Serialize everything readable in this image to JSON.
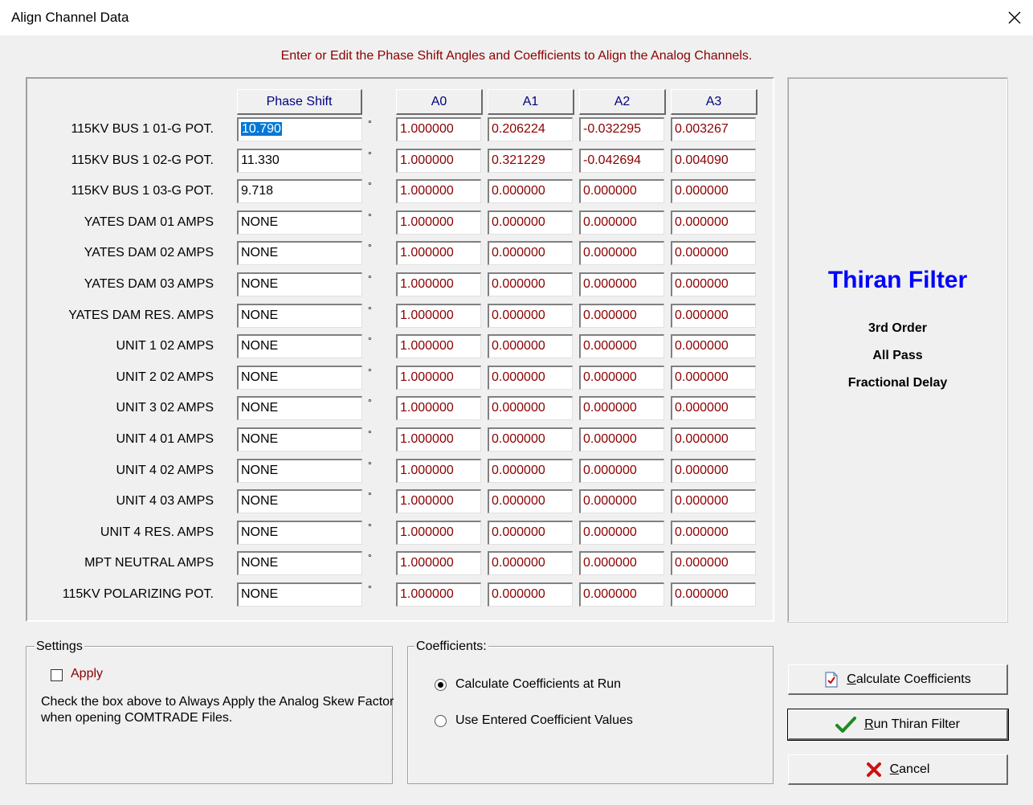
{
  "window": {
    "title": "Align Channel Data",
    "close_symbol": "✕"
  },
  "instruction": "Enter or Edit the Phase Shift Angles and Coefficients to Align the Analog Channels.",
  "headers": {
    "phase_shift": "Phase Shift",
    "a0": "A0",
    "a1": "A1",
    "a2": "A2",
    "a3": "A3"
  },
  "degree_symbol": "°",
  "rows": [
    {
      "label": "115KV BUS 1 01-G POT.",
      "phase": "10.790",
      "a0": "1.000000",
      "a1": "0.206224",
      "a2": "-0.032295",
      "a3": "0.003267"
    },
    {
      "label": "115KV BUS 1 02-G POT.",
      "phase": "11.330",
      "a0": "1.000000",
      "a1": "0.321229",
      "a2": "-0.042694",
      "a3": "0.004090"
    },
    {
      "label": "115KV BUS 1 03-G POT.",
      "phase": "9.718",
      "a0": "1.000000",
      "a1": "0.000000",
      "a2": "0.000000",
      "a3": "0.000000"
    },
    {
      "label": "YATES DAM 01 AMPS",
      "phase": "NONE",
      "a0": "1.000000",
      "a1": "0.000000",
      "a2": "0.000000",
      "a3": "0.000000"
    },
    {
      "label": "YATES DAM 02 AMPS",
      "phase": "NONE",
      "a0": "1.000000",
      "a1": "0.000000",
      "a2": "0.000000",
      "a3": "0.000000"
    },
    {
      "label": "YATES DAM 03 AMPS",
      "phase": "NONE",
      "a0": "1.000000",
      "a1": "0.000000",
      "a2": "0.000000",
      "a3": "0.000000"
    },
    {
      "label": "YATES DAM RES. AMPS",
      "phase": "NONE",
      "a0": "1.000000",
      "a1": "0.000000",
      "a2": "0.000000",
      "a3": "0.000000"
    },
    {
      "label": "UNIT 1 02 AMPS",
      "phase": "NONE",
      "a0": "1.000000",
      "a1": "0.000000",
      "a2": "0.000000",
      "a3": "0.000000"
    },
    {
      "label": "UNIT 2 02 AMPS",
      "phase": "NONE",
      "a0": "1.000000",
      "a1": "0.000000",
      "a2": "0.000000",
      "a3": "0.000000"
    },
    {
      "label": "UNIT 3 02 AMPS",
      "phase": "NONE",
      "a0": "1.000000",
      "a1": "0.000000",
      "a2": "0.000000",
      "a3": "0.000000"
    },
    {
      "label": "UNIT 4 01 AMPS",
      "phase": "NONE",
      "a0": "1.000000",
      "a1": "0.000000",
      "a2": "0.000000",
      "a3": "0.000000"
    },
    {
      "label": "UNIT 4 02 AMPS",
      "phase": "NONE",
      "a0": "1.000000",
      "a1": "0.000000",
      "a2": "0.000000",
      "a3": "0.000000"
    },
    {
      "label": "UNIT 4 03 AMPS",
      "phase": "NONE",
      "a0": "1.000000",
      "a1": "0.000000",
      "a2": "0.000000",
      "a3": "0.000000"
    },
    {
      "label": "UNIT 4 RES. AMPS",
      "phase": "NONE",
      "a0": "1.000000",
      "a1": "0.000000",
      "a2": "0.000000",
      "a3": "0.000000"
    },
    {
      "label": "MPT NEUTRAL AMPS",
      "phase": "NONE",
      "a0": "1.000000",
      "a1": "0.000000",
      "a2": "0.000000",
      "a3": "0.000000"
    },
    {
      "label": "115KV POLARIZING POT.",
      "phase": "NONE",
      "a0": "1.000000",
      "a1": "0.000000",
      "a2": "0.000000",
      "a3": "0.000000"
    }
  ],
  "filter": {
    "title": "Thiran Filter",
    "line1": "3rd Order",
    "line2": "All Pass",
    "line3": "Fractional Delay"
  },
  "settings": {
    "group_label": "Settings",
    "apply_label": "Apply",
    "apply_checked": false,
    "description": "Check the box above to Always Apply the Analog Skew Factor when opening COMTRADE Files."
  },
  "coefficients": {
    "group_label": "Coefficients:",
    "option_calculate": "Calculate Coefficients at Run",
    "option_entered": "Use Entered Coefficient Values",
    "selected": "calculate"
  },
  "buttons": {
    "calculate_mnemonic": "C",
    "calculate_rest": "alculate Coefficients",
    "run_mnemonic": "R",
    "run_rest": "un Thiran Filter",
    "cancel_mnemonic": "C",
    "cancel_rest": "ancel"
  },
  "colors": {
    "accent_text": "#8b0000",
    "header_text": "#000080",
    "filter_title": "#0000ff",
    "selection": "#0078d7"
  }
}
